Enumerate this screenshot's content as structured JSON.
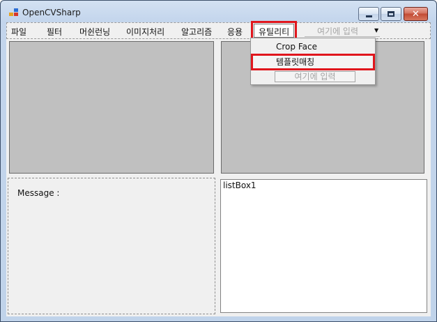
{
  "window": {
    "title": "OpenCVSharp"
  },
  "menu": {
    "items": [
      {
        "label": "파일"
      },
      {
        "label": "필터"
      },
      {
        "label": "머쉰런닝"
      },
      {
        "label": "이미지처리"
      },
      {
        "label": "알고리즘"
      },
      {
        "label": "응용"
      },
      {
        "label": "유틸리티"
      }
    ],
    "toolstrip_input_placeholder": "여기에 입력"
  },
  "dropdown": {
    "items": [
      {
        "label": "Crop Face"
      },
      {
        "label": "템플릿매칭"
      }
    ],
    "input_placeholder": "여기에 입력"
  },
  "message_label": "Message :",
  "listbox_item": "listBox1",
  "colors": {
    "highlight": "#e0161d",
    "picture_bg": "#c0c0c0",
    "form_bg": "#f0f0f0"
  }
}
